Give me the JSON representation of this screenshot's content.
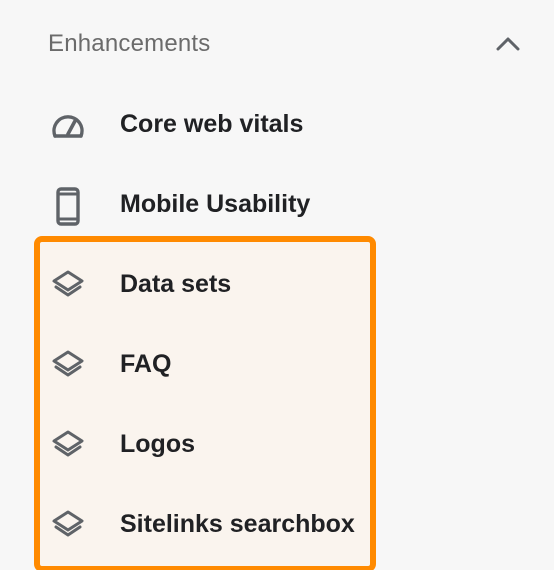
{
  "section": {
    "title": "Enhancements",
    "expanded": true
  },
  "nav": {
    "items": [
      {
        "label": "Core web vitals",
        "icon": "speedometer-icon"
      },
      {
        "label": "Mobile Usability",
        "icon": "smartphone-icon"
      },
      {
        "label": "Data sets",
        "icon": "layers-icon"
      },
      {
        "label": "FAQ",
        "icon": "layers-icon"
      },
      {
        "label": "Logos",
        "icon": "layers-icon"
      },
      {
        "label": "Sitelinks searchbox",
        "icon": "layers-icon"
      }
    ]
  },
  "colors": {
    "highlight_border": "#ff8a00",
    "highlight_fill": "#faf4ee",
    "icon": "#5f6368",
    "label": "#202124",
    "section_title": "#6b6b6b"
  }
}
